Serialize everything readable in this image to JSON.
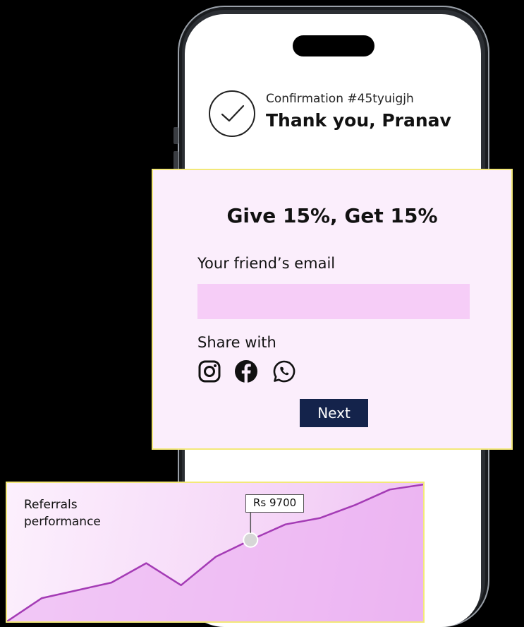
{
  "confirmation": {
    "number": "Confirmation #45tyuigjh",
    "thank_you": "Thank you, Pranav"
  },
  "referral": {
    "title": "Give 15%, Get 15%",
    "email_label": "Your friend’s email",
    "email_value": "",
    "share_label": "Share with",
    "social": [
      "instagram-icon",
      "facebook-icon",
      "whatsapp-icon"
    ],
    "next_label": "Next"
  },
  "performance": {
    "label": "Referrals performance",
    "tooltip": "Rs 9700",
    "trend": [
      0,
      18,
      24,
      30,
      45,
      28,
      50,
      63,
      75,
      80,
      90,
      102,
      106
    ]
  },
  "colors": {
    "card_bg": "#fbeefc",
    "card_border": "#f3e879",
    "input_bg": "#f6cdf7",
    "button_bg": "#14234b",
    "line": "#a43bb5"
  }
}
